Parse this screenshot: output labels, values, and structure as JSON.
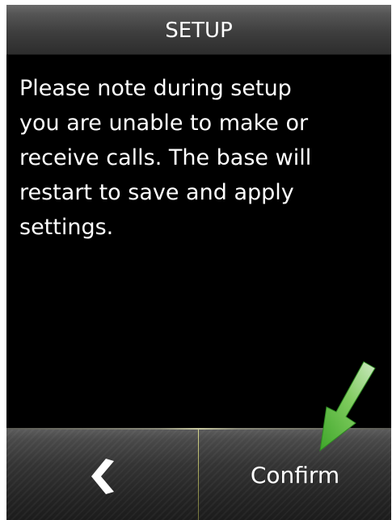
{
  "header": {
    "title": "SETUP"
  },
  "main": {
    "message_lines": [
      "Please note during setup",
      "you are unable to make or",
      "receive calls. The base will",
      "restart to save and apply",
      "settings."
    ]
  },
  "softkeys": {
    "left_icon": "chevron-left-icon",
    "right_label": "Confirm"
  },
  "annotation": {
    "icon": "arrow-down-left-icon",
    "color": "#4fb830"
  },
  "colors": {
    "screen_background": "#000000",
    "text": "#ffffff",
    "divider_accent": "#c8c890"
  }
}
